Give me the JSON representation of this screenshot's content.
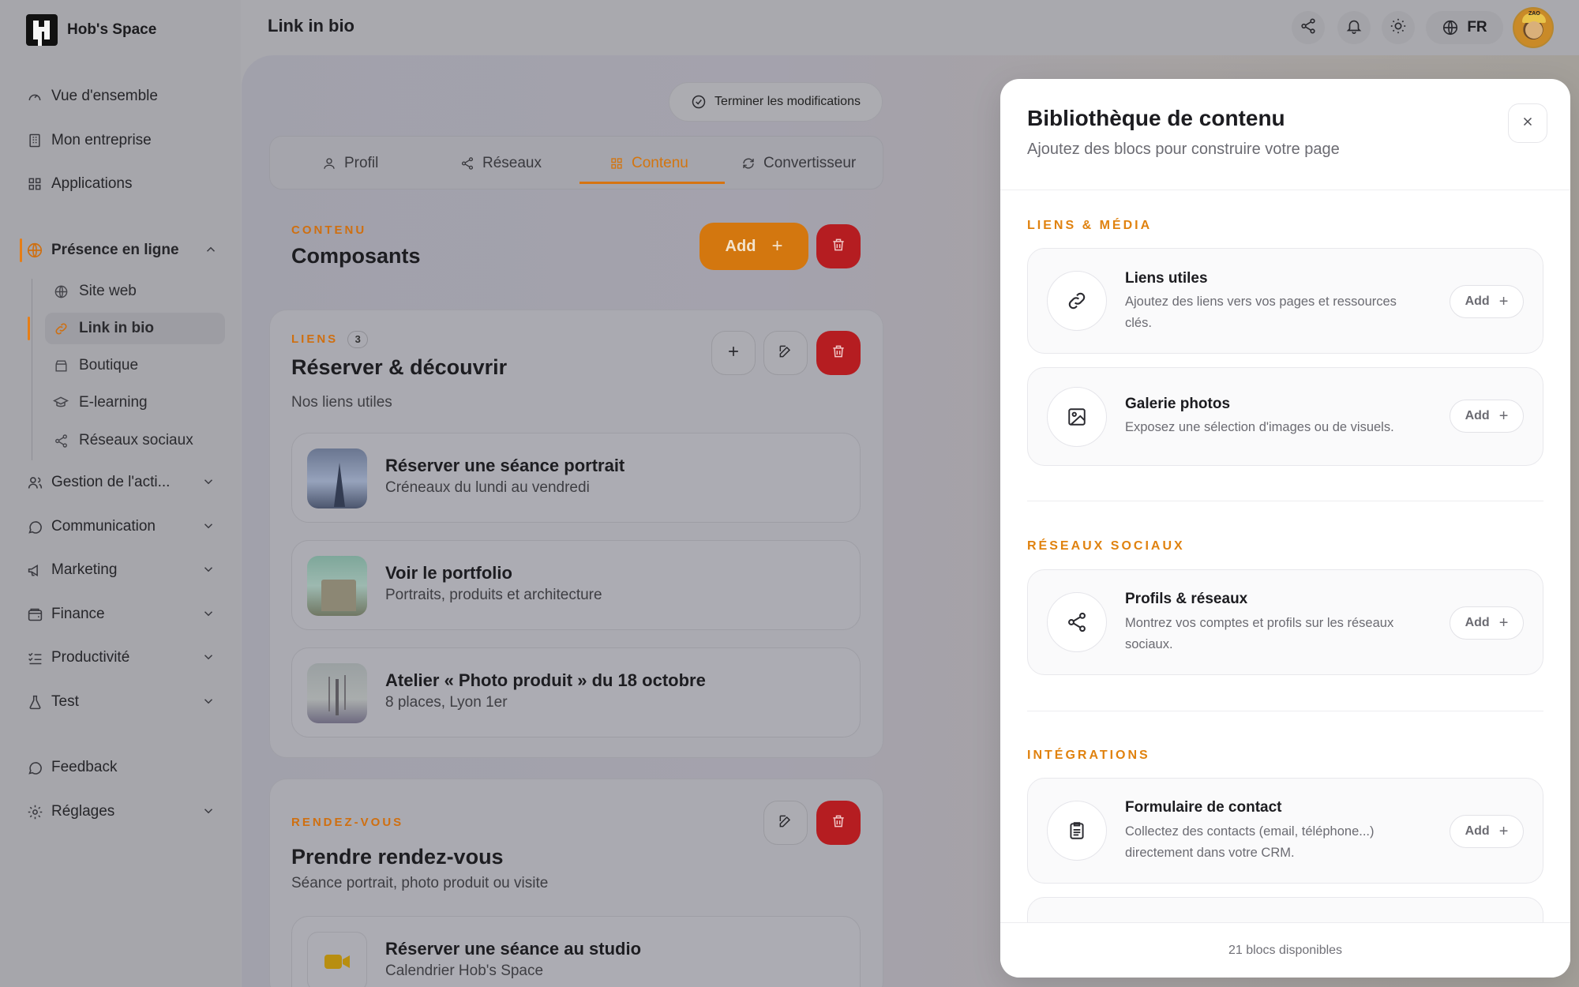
{
  "brand": {
    "name": "Hob's Space"
  },
  "topbar": {
    "title": "Link in bio",
    "lang": "FR",
    "avatar_tag": "ZAO"
  },
  "sidebar": {
    "items": [
      {
        "label": "Vue d'ensemble",
        "icon": "gauge-icon"
      },
      {
        "label": "Mon entreprise",
        "icon": "building-icon"
      },
      {
        "label": "Applications",
        "icon": "grid-icon"
      }
    ],
    "presence": {
      "label": "Présence en ligne",
      "icon": "globe-icon",
      "children": [
        {
          "label": "Site web",
          "icon": "globe-icon"
        },
        {
          "label": "Link in bio",
          "icon": "link-icon"
        },
        {
          "label": "Boutique",
          "icon": "store-icon"
        },
        {
          "label": "E-learning",
          "icon": "graduation-icon"
        },
        {
          "label": "Réseaux sociaux",
          "icon": "share-icon"
        }
      ]
    },
    "groups": [
      {
        "label": "Gestion de l'acti...",
        "icon": "users-icon"
      },
      {
        "label": "Communication",
        "icon": "chat-icon"
      },
      {
        "label": "Marketing",
        "icon": "megaphone-icon"
      },
      {
        "label": "Finance",
        "icon": "wallet-icon"
      },
      {
        "label": "Productivité",
        "icon": "checklist-icon"
      },
      {
        "label": "Test",
        "icon": "flask-icon"
      }
    ],
    "footer": [
      {
        "label": "Feedback",
        "icon": "chat-icon"
      },
      {
        "label": "Réglages",
        "icon": "gear-icon"
      }
    ]
  },
  "editor": {
    "finish_label": "Terminer les modifications",
    "tabs": [
      "Profil",
      "Réseaux",
      "Contenu",
      "Convertisseur"
    ],
    "active_tab": "Contenu",
    "components": {
      "eyebrow": "CONTENU",
      "title": "Composants",
      "add_label": "Add"
    },
    "links_card": {
      "eyebrow": "LIENS",
      "count": "3",
      "title": "Réserver & découvrir",
      "subtitle": "Nos liens utiles",
      "items": [
        {
          "title": "Réserver une séance portrait",
          "subtitle": "Créneaux du lundi au vendredi"
        },
        {
          "title": "Voir le portfolio",
          "subtitle": "Portraits, produits et architecture"
        },
        {
          "title": "Atelier « Photo produit » du 18 octobre",
          "subtitle": "8 places, Lyon 1er"
        }
      ]
    },
    "rdv_card": {
      "eyebrow": "RENDEZ-VOUS",
      "title": "Prendre rendez-vous",
      "subtitle": "Séance portrait, photo produit ou visite",
      "item": {
        "title": "Réserver une séance au studio",
        "subtitle": "Calendrier Hob's Space"
      }
    }
  },
  "library": {
    "title": "Bibliothèque de contenu",
    "subtitle": "Ajoutez des blocs pour construire votre page",
    "add_label": "Add",
    "sections": [
      {
        "title": "LIENS & MÉDIA",
        "blocks": [
          {
            "title": "Liens utiles",
            "desc": "Ajoutez des liens vers vos pages et ressources clés.",
            "icon": "link-icon"
          },
          {
            "title": "Galerie photos",
            "desc": "Exposez une sélection d'images ou de visuels.",
            "icon": "image-icon"
          }
        ]
      },
      {
        "title": "RÉSEAUX SOCIAUX",
        "blocks": [
          {
            "title": "Profils & réseaux",
            "desc": "Montrez vos comptes et profils sur les réseaux sociaux.",
            "icon": "share-icon"
          }
        ]
      },
      {
        "title": "INTÉGRATIONS",
        "blocks": [
          {
            "title": "Formulaire de contact",
            "desc": "Collectez des contacts (email, téléphone...) directement dans votre CRM.",
            "icon": "clipboard-icon"
          }
        ]
      }
    ],
    "footer": "21 blocs disponibles"
  },
  "colors": {
    "accent": "#e0820f",
    "danger": "#b51d21"
  }
}
